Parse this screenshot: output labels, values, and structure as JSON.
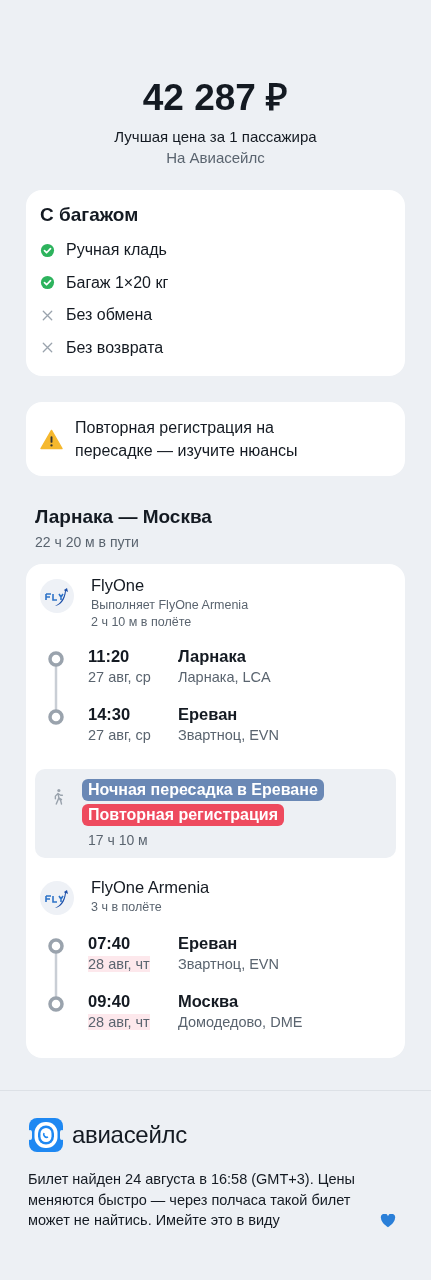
{
  "price": {
    "amount": "42 287 ₽",
    "caption": "Лучшая цена за 1 пассажира",
    "source": "На Авиасейлс"
  },
  "baggage": {
    "title": "С багажом",
    "items": [
      {
        "label": "Ручная кладь",
        "included": true
      },
      {
        "label": "Багаж 1×20 кг",
        "included": true
      },
      {
        "label": "Без обмена",
        "included": false
      },
      {
        "label": "Без возврата",
        "included": false
      }
    ]
  },
  "warning": {
    "text": "Повторная регистрация на пересадке — изучите нюансы"
  },
  "route": {
    "title": "Ларнака — Москва",
    "duration": "22 ч 20 м в пути"
  },
  "segments": [
    {
      "kind": "flight",
      "airline": "FlyOne",
      "operator": "Выполняет FlyOne Armenia",
      "flight_time": "2 ч 10 м в полёте",
      "stops": [
        {
          "time": "11:20",
          "date": "27 авг, ср",
          "next_day": false,
          "city": "Ларнака",
          "airport": "Ларнака, LCA"
        },
        {
          "time": "14:30",
          "date": "27 авг, ср",
          "next_day": false,
          "city": "Ереван",
          "airport": "Звартноц, EVN"
        }
      ]
    },
    {
      "kind": "layover",
      "tags": [
        {
          "label": "Ночная пересадка в Ереване",
          "color": "#6a88b5"
        },
        {
          "label": "Повторная регистрация",
          "color": "#ee4a5e"
        }
      ],
      "duration": "17 ч 10 м"
    },
    {
      "kind": "flight",
      "airline": "FlyOne Armenia",
      "flight_time": "3 ч в полёте",
      "stops": [
        {
          "time": "07:40",
          "date": "28 авг, чт",
          "next_day": true,
          "city": "Ереван",
          "airport": "Звартноц, EVN"
        },
        {
          "time": "09:40",
          "date": "28 авг, чт",
          "next_day": true,
          "city": "Москва",
          "airport": "Домодедово, DME"
        }
      ]
    }
  ],
  "footer": {
    "brand": "авиасейлс",
    "note": "Билет найден 24 августа в 16:58 (GMT+3). Цены меняются быстро — через полчаса такой билет может не найтись. Имейте это в виду"
  }
}
